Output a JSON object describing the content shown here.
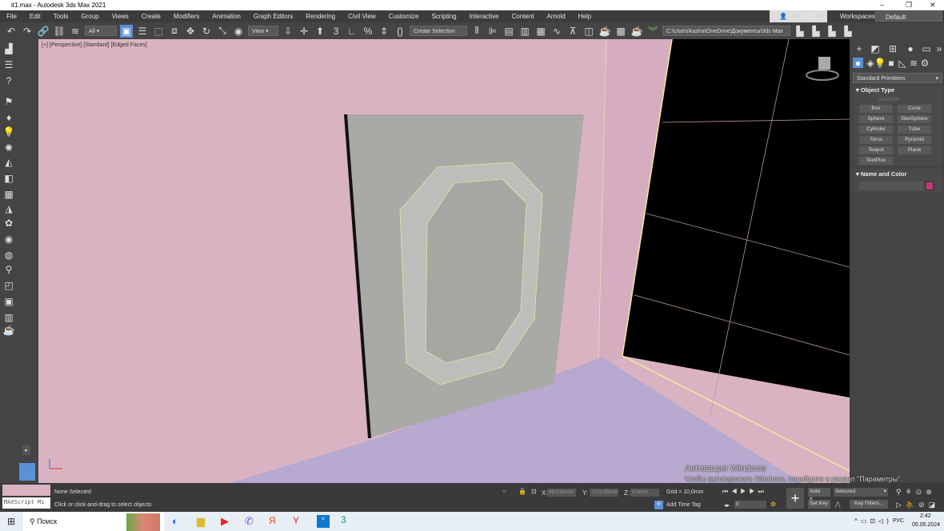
{
  "window": {
    "title": "it1.max - Autodesk 3ds Max 2021",
    "controls": [
      "–",
      "❐",
      "✕"
    ]
  },
  "menu": [
    "File",
    "Edit",
    "Tools",
    "Group",
    "Views",
    "Create",
    "Modifiers",
    "Animation",
    "Graph Editors",
    "Rendering",
    "Civil View",
    "Customize",
    "Scripting",
    "Interactive",
    "Content",
    "Arnold",
    "Help"
  ],
  "signin": {
    "label": "Sign In"
  },
  "workspaces": {
    "label": "Workspaces:",
    "value": "Default"
  },
  "toolbar": {
    "filter": "All",
    "ref_coord": "View",
    "selection_set": "Create Selection Se",
    "project_path": "C:\\Users\\kasha\\OneDrive\\Документы\\3ds Max 2021"
  },
  "viewport": {
    "label": "[+] [Perspective] [Standard] [Edged Faces]",
    "colors": {
      "wall": "#dab3c3",
      "floor": "#b7a9cf",
      "door": "#a9a9a6",
      "void": "#000000",
      "edge": "#f0e6a0"
    }
  },
  "panel": {
    "category": "Standard Primitives",
    "object_type": "Object Type",
    "autogrid": "AutoGrid",
    "buttons": [
      "Box",
      "Cone",
      "Sphere",
      "GeoSphere",
      "Cylinder",
      "Tube",
      "Torus",
      "Pyramid",
      "Teapot",
      "Plane",
      "TextPlus"
    ],
    "name_color": "Name and Color",
    "swatch": "#c8357e"
  },
  "status": {
    "maxscript": "MAXScript Mi",
    "selected": "None Selected",
    "prompt": "Click or click-and-drag to select objects",
    "x_label": "X:",
    "x": "99,016mm",
    "y_label": "Y:",
    "y": "-273,05mm",
    "z_label": "Z:",
    "z": "0,0mm",
    "grid": "Grid = 10,0mm",
    "add_time_tag": "Add Time Tag",
    "frame": "0",
    "auto_key": "Auto K...",
    "set_key": "Set Key",
    "key_mode": "Selected",
    "key_filters": "Key Filters..."
  },
  "watermark": {
    "line1": "Активация Windows",
    "line2": "Чтобы активировать Windows, перейдите в раздел \"Параметры\"."
  },
  "taskbar": {
    "search": "Поиск",
    "lang": "РУС",
    "time": "2:42",
    "date": "05.05.2024"
  }
}
